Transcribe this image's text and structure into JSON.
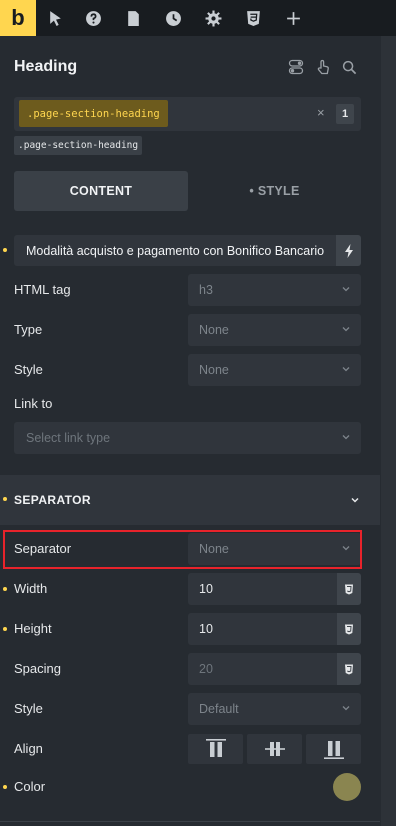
{
  "topbar": {
    "logo": "b",
    "icons": [
      "cursor-icon",
      "help-icon",
      "page-icon",
      "history-icon",
      "settings-icon",
      "css3-icon",
      "plus-icon"
    ]
  },
  "panel": {
    "title": "Heading",
    "header_icons": [
      "toggle-icon",
      "hand-pointer-icon",
      "search-icon"
    ]
  },
  "class_selector": {
    "active_class": ".page-section-heading",
    "count": "1",
    "close_symbol": "×",
    "chip": ".page-section-heading"
  },
  "tabs": {
    "content": "CONTENT",
    "style": "• STYLE"
  },
  "heading_text": "Modalità acquisto e pagamento con Bonifico Bancario",
  "fields": {
    "html_tag": {
      "label": "HTML tag",
      "value": "h3"
    },
    "type": {
      "label": "Type",
      "value": "None"
    },
    "style": {
      "label": "Style",
      "value": "None"
    },
    "link_to": {
      "label": "Link to",
      "placeholder": "Select link type"
    }
  },
  "separator_section": {
    "title": "SEPARATOR",
    "separator": {
      "label": "Separator",
      "value": "None"
    },
    "width": {
      "label": "Width",
      "value": "10"
    },
    "height": {
      "label": "Height",
      "value": "10"
    },
    "spacing": {
      "label": "Spacing",
      "value": "20"
    },
    "style": {
      "label": "Style",
      "value": "Default"
    },
    "align": {
      "label": "Align"
    },
    "color": {
      "label": "Color",
      "value": "#8a8550"
    }
  },
  "colors": {
    "accent": "#ffd64f",
    "highlight": "#e8232b"
  }
}
